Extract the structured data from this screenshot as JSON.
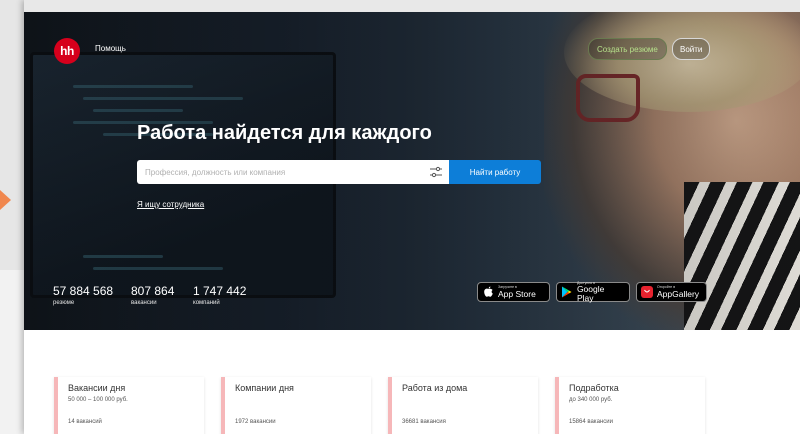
{
  "header": {
    "logo_text": "hh",
    "help_label": "Помощь",
    "create_resume_label": "Создать резюме",
    "login_label": "Войти"
  },
  "hero": {
    "headline": "Работа найдется для каждого",
    "search": {
      "placeholder": "Профессия, должность или компания",
      "button_label": "Найти работу"
    },
    "employer_link": "Я ищу сотрудника"
  },
  "stats": [
    {
      "value": "57 884 568",
      "label": "резюме"
    },
    {
      "value": "807 864",
      "label": "вакансии"
    },
    {
      "value": "1 747 442",
      "label": "компаний"
    }
  ],
  "app_stores": [
    {
      "small": "Загрузите в",
      "big": "App Store",
      "icon": "apple-icon"
    },
    {
      "small": "Доступно в",
      "big": "Google Play",
      "icon": "google-play-icon"
    },
    {
      "small": "Откройте в",
      "big": "AppGallery",
      "icon": "appgallery-icon"
    }
  ],
  "cards": [
    {
      "title": "Вакансии дня",
      "subtitle": "50 000 – 100 000 руб.",
      "count": "14 вакансий"
    },
    {
      "title": "Компании дня",
      "subtitle": "",
      "count": "1972 вакансии"
    },
    {
      "title": "Работа из дома",
      "subtitle": "",
      "count": "36681 вакансия"
    },
    {
      "title": "Подработка",
      "subtitle": "до 340 000 руб.",
      "count": "15864 вакансии"
    }
  ],
  "colors": {
    "brand_red": "#d6001c",
    "search_button_blue": "#0d7ed8",
    "card_accent_pink": "#f6b7b9",
    "resume_button_green": "#b6e08a",
    "page_arrow_orange": "#f0874e"
  }
}
